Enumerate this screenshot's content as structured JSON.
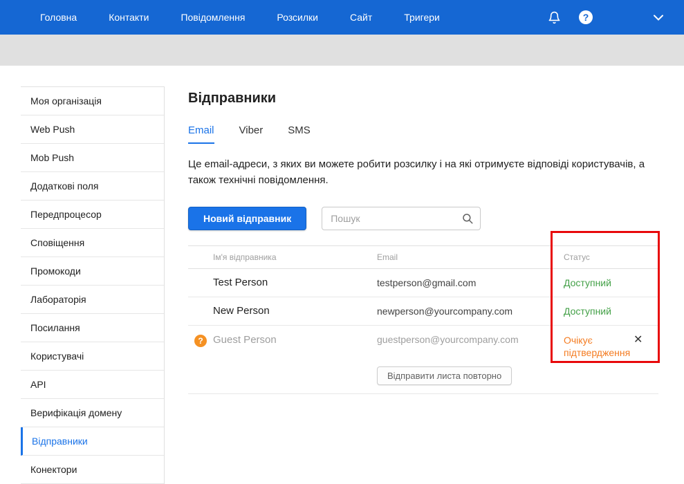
{
  "topnav": {
    "items": [
      "Головна",
      "Контакти",
      "Повідомлення",
      "Розсилки",
      "Сайт",
      "Тригери"
    ],
    "icons": [
      "bell-icon",
      "help-icon",
      "chevron-down-icon"
    ],
    "help_glyph": "?"
  },
  "sidebar": {
    "items": [
      {
        "label": "Моя організація",
        "active": false
      },
      {
        "label": "Web Push",
        "active": false
      },
      {
        "label": "Mob Push",
        "active": false
      },
      {
        "label": "Додаткові поля",
        "active": false
      },
      {
        "label": "Передпроцесор",
        "active": false
      },
      {
        "label": "Сповіщення",
        "active": false
      },
      {
        "label": "Промокоди",
        "active": false
      },
      {
        "label": "Лабораторія",
        "active": false
      },
      {
        "label": "Посилання",
        "active": false
      },
      {
        "label": "Користувачі",
        "active": false
      },
      {
        "label": "API",
        "active": false
      },
      {
        "label": "Верифікація домену",
        "active": false
      },
      {
        "label": "Відправники",
        "active": true
      },
      {
        "label": "Конектори",
        "active": false
      }
    ]
  },
  "main": {
    "title": "Відправники",
    "tabs": [
      {
        "label": "Email",
        "active": true
      },
      {
        "label": "Viber",
        "active": false
      },
      {
        "label": "SMS",
        "active": false
      }
    ],
    "description": "Це email-адреси, з яких ви можете робити розсилку і на які отримуєте відповіді користувачів, а також технічні повідомлення.",
    "new_sender_button": "Новий відправник",
    "search_placeholder": "Пошук",
    "table": {
      "headers": [
        "Ім'я відправника",
        "Email",
        "Статус"
      ],
      "rows": [
        {
          "name": "Test Person",
          "email": "testperson@gmail.com",
          "status": "Доступний",
          "status_type": "available"
        },
        {
          "name": "New Person",
          "email": "newperson@yourcompany.com",
          "status": "Доступний",
          "status_type": "available"
        },
        {
          "name": "Guest Person",
          "email": "guestperson@yourcompany.com",
          "status": "Очікує підтвердження",
          "status_type": "pending",
          "help_glyph": "?",
          "close_glyph": "✕",
          "resend_button": "Відправити листа повторно"
        }
      ]
    }
  },
  "colors": {
    "nav_bg": "#1567d3",
    "accent_blue": "#1a73e8",
    "status_available": "#43a047",
    "status_pending": "#f47b20",
    "pending_icon_bg": "#f59123",
    "highlight_red": "#e8090b",
    "band_gray": "#e0e0e0"
  }
}
